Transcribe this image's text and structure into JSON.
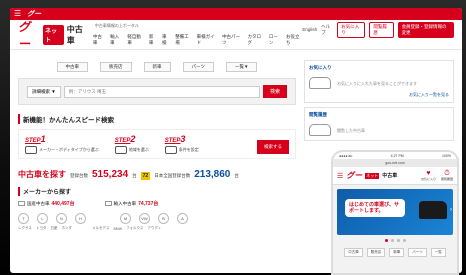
{
  "brand": {
    "logo": "グー",
    "net_badge": "ネット",
    "used": "中古車",
    "tagline_1": "中古車情報の上ポータル",
    "tagline_2": "中古車検索なら"
  },
  "top_nav": [
    "中古車",
    "輸入車",
    "軽自動車",
    "新車",
    "車検",
    "整備工場",
    "車検ガイド",
    "中古パーツ",
    "カタログ",
    "ローン",
    "お役立ち"
  ],
  "header_links": {
    "english": "English",
    "help": "ヘルプ",
    "favorites": "お気に入り",
    "history": "閲覧履歴",
    "login": "会員登録・登録情報の変更"
  },
  "search": {
    "tabs": [
      "中古車",
      "販売店",
      "新車",
      "パーツ",
      "一覧▼"
    ],
    "select_label": "詳細検索 ▼",
    "placeholder": "例：アリウス 埼玉",
    "button": "検索"
  },
  "quick_search": {
    "title": "新機能！かんたんスピード検索",
    "steps": [
      {
        "num": "1",
        "label": "STEP",
        "desc": "メーカー・ボディタイプから選ぶ"
      },
      {
        "num": "2",
        "label": "STEP",
        "desc": "地域を選ぶ"
      },
      {
        "num": "3",
        "label": "STEP",
        "desc": "条件を設定"
      }
    ],
    "button": "検索する"
  },
  "counts": {
    "title": "中古車を探す",
    "registered_label": "登録台数",
    "registered_value": "515,234",
    "unit": "台",
    "badge": "72",
    "new_label": "日本全国登録台数",
    "new_value": "213,860",
    "unit2": "台"
  },
  "makers": {
    "title": "メーカーから探す",
    "domestic_label": "国産中古車",
    "domestic_count": "440,497台",
    "import_label": "輸入中古車",
    "import_count": "74,737台",
    "logos": [
      "T",
      "L",
      "N",
      "H",
      "M",
      "VW",
      "B",
      "A"
    ],
    "names": [
      "レクサス",
      "トヨタ",
      "日産",
      "ホンダ",
      "メルセデス",
      "BMW",
      "フォルクス",
      "アウディ"
    ]
  },
  "sidebar": {
    "favorites_title": "お気に入り",
    "favorites_text": "お気に入りに入れた車を見ることができます",
    "favorites_link": "お気に入り一覧を見る",
    "history_title": "閲覧履歴",
    "history_text": "閲覧した中古車"
  },
  "promo": {
    "text": "期間限定"
  },
  "phone": {
    "time": "4:27 PM",
    "carrier": "●●●● au",
    "battery": "100%",
    "url": "goo-net.com",
    "logo": "グー",
    "net": "ネット",
    "used": "中古車",
    "icons": [
      {
        "glyph": "♥",
        "label": "お気に入り"
      },
      {
        "glyph": "⏱",
        "label": "閲覧履歴"
      }
    ],
    "bubble": "はじめての車選び、サポートします。",
    "tabs": [
      "中古車",
      "販売店",
      "新車",
      "パーツ",
      "一覧"
    ]
  },
  "colors": {
    "brand_red": "#d6001c",
    "accent_blue": "#0b4ea2",
    "badge_yellow": "#f0c000"
  }
}
